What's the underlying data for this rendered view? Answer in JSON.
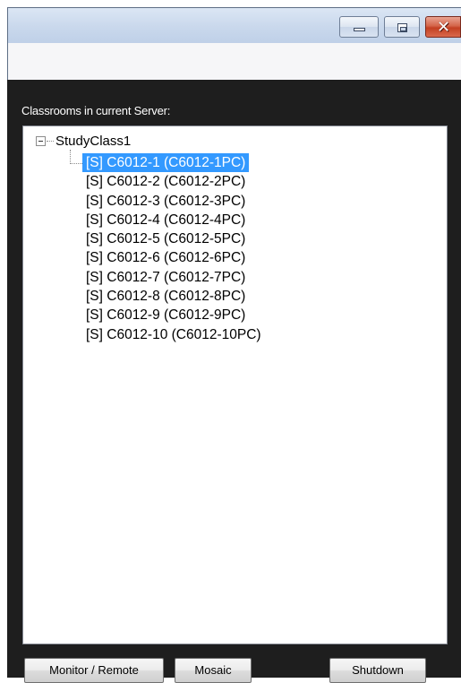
{
  "window": {
    "caption_buttons": [
      {
        "name": "minimize-button",
        "icon": "minimize-icon"
      },
      {
        "name": "maximize-button",
        "icon": "maximize-icon"
      },
      {
        "name": "close-button",
        "icon": "close-icon",
        "glyph": "✕"
      }
    ]
  },
  "classrooms": {
    "label": "Classrooms in current Server:",
    "root": "StudyClass1",
    "items": [
      "[S] C6012-1 (C6012-1PC)",
      "[S] C6012-2 (C6012-2PC)",
      "[S] C6012-3 (C6012-3PC)",
      "[S] C6012-4 (C6012-4PC)",
      "[S] C6012-5 (C6012-5PC)",
      "[S] C6012-6 (C6012-6PC)",
      "[S] C6012-7 (C6012-7PC)",
      "[S] C6012-8 (C6012-8PC)",
      "[S] C6012-9 (C6012-9PC)",
      "[S] C6012-10 (C6012-10PC)"
    ],
    "selected_item": "[S] C6012-1 (C6012-1PC)"
  },
  "actions": {
    "monitor_remote": "Monitor / Remote",
    "mosaic": "Mosaic",
    "shutdown": "Shutdown"
  },
  "colors": {
    "selection": "#3399ff",
    "client_background": "#1e1e1e",
    "close_button": "#c33f22"
  }
}
